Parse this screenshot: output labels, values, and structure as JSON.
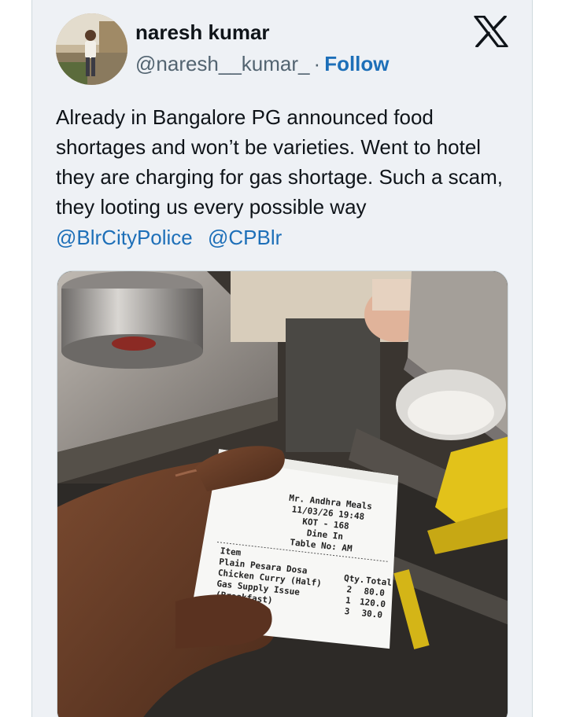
{
  "user": {
    "display_name": "naresh kumar",
    "handle": "@naresh__kumar_",
    "separator": "·",
    "follow_label": "Follow"
  },
  "icons": {
    "brand_logo": "x-logo-icon",
    "avatar": "profile-photo"
  },
  "tweet": {
    "text": "Already in Bangalore PG announced food shortages and won’t be varieties. Went to hotel they are charging for gas shortage. Such a scam, they looting us every possible way",
    "mentions": [
      "@BlrCityPolice",
      "@CPBlr"
    ]
  },
  "receipt": {
    "restaurant": "Mr. Andhra Meals",
    "datetime": "11/03/26 19:48",
    "kot": "KOT - 168",
    "service": "Dine In",
    "table": "Table No: AM",
    "item_header": "Item",
    "qty_header": "Qty.",
    "total_header": "Total",
    "items": [
      {
        "name": "Plain Pesara Dosa",
        "qty": "2",
        "total": "80.0"
      },
      {
        "name": "Chicken Curry (Half)",
        "qty": "1",
        "total": "120.0"
      },
      {
        "name": "Gas Supply Issue",
        "qty": "3",
        "total": "30.0"
      },
      {
        "name": "(Breakfast)",
        "qty": "",
        "total": ""
      }
    ]
  },
  "colors": {
    "card_bg": "#eef1f5",
    "link": "#1d6fb8",
    "text": "#0f1419",
    "secondary": "#536471"
  }
}
